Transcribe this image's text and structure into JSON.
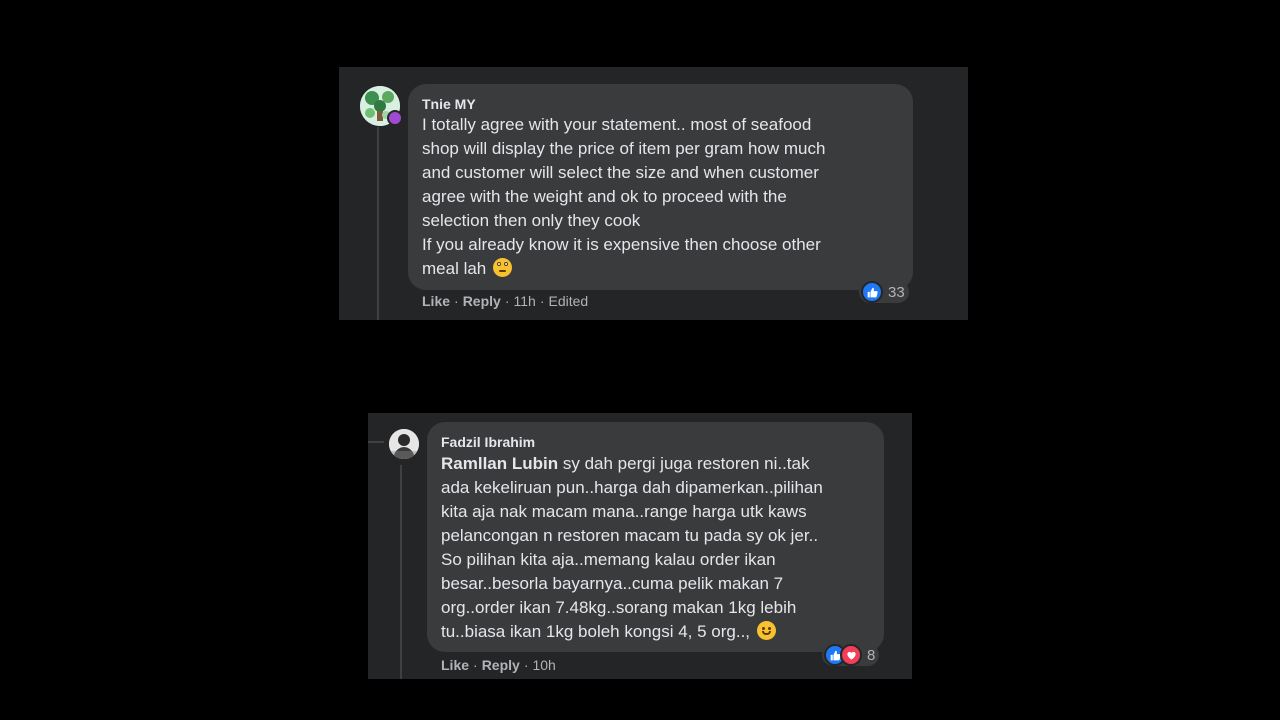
{
  "comments": [
    {
      "author": "Tnie MY",
      "lines": [
        "I totally agree with your statement.. most of seafood",
        "shop will display the price of item per gram how much",
        "and customer will select the size and when customer",
        "agree with the weight and ok to proceed with the",
        "selection then only they cook",
        "If you already know it is expensive then choose other",
        "meal lah"
      ],
      "emoji": "face-with-rolling-eyes",
      "actions": {
        "like": "Like",
        "reply": "Reply",
        "time": "11h",
        "edited": "Edited"
      },
      "reactions": {
        "types": [
          "like"
        ],
        "count": "33"
      }
    },
    {
      "author": "Fadzil Ibrahim",
      "mention": "Ramllan Lubin",
      "lines": [
        " sy dah pergi juga restoren ni..tak",
        "ada kekeliruan pun..harga dah dipamerkan..pilihan",
        "kita aja nak macam mana..range harga utk kaws",
        "pelancongan n restoren macam tu pada sy ok jer..",
        "So pilihan kita aja..memang kalau order ikan",
        "besar..besorla bayarnya..cuma pelik makan 7",
        "org..order ikan 7.48kg..sorang makan 1kg lebih",
        "tu..biasa ikan 1kg boleh kongsi 4, 5 org..,"
      ],
      "emoji": "slightly-smiling-face",
      "actions": {
        "like": "Like",
        "reply": "Reply",
        "time": "10h"
      },
      "reactions": {
        "types": [
          "like",
          "love"
        ],
        "count": "8"
      }
    }
  ],
  "colors": {
    "background": "#000000",
    "panel": "#242526",
    "bubble": "#3a3b3c",
    "text": "#e4e6eb",
    "secondary": "#b0b3b8",
    "like": "#2078f4",
    "love": "#f33e58"
  }
}
